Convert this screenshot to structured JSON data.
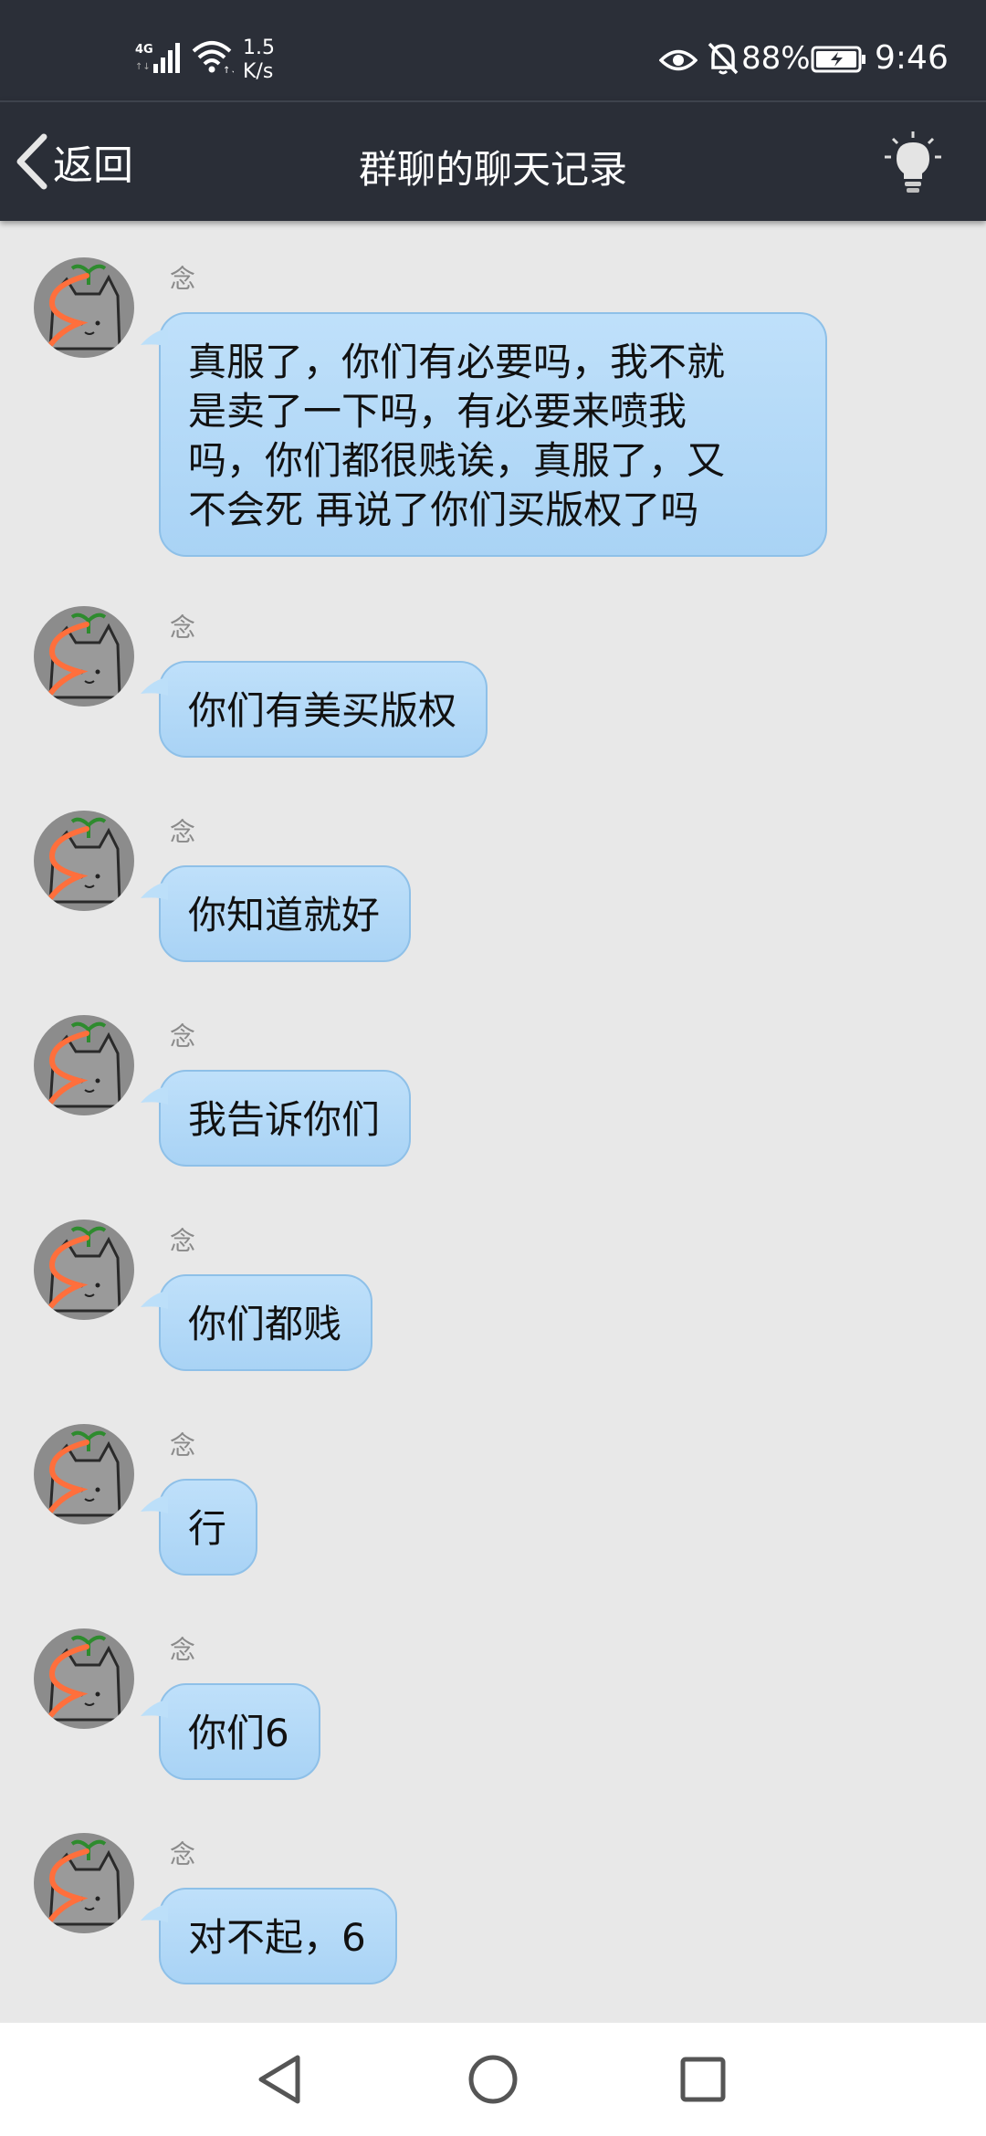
{
  "status_bar": {
    "network": "4G",
    "speed_value": "1.5",
    "speed_unit": "K/s",
    "battery": "88%",
    "time": "9:46"
  },
  "title_bar": {
    "back_label": "返回",
    "title": "群聊的聊天记录"
  },
  "messages": [
    {
      "sender": "念",
      "lines": [
        "真服了，你们有必要吗，我不就",
        "是卖了一下吗，有必要来喷我",
        "吗，你们都很贱诶，真服了，又",
        "不会死 再说了你们买版权了吗"
      ]
    },
    {
      "sender": "念",
      "text": "你们有美买版权"
    },
    {
      "sender": "念",
      "text": "你知道就好"
    },
    {
      "sender": "念",
      "text": "我告诉你们"
    },
    {
      "sender": "念",
      "text": "你们都贱"
    },
    {
      "sender": "念",
      "text": "行"
    },
    {
      "sender": "念",
      "text": "你们6"
    },
    {
      "sender": "念",
      "text": "对不起，6"
    }
  ],
  "icons": {
    "back": "chevron-left-icon",
    "bulb": "lightbulb-icon",
    "nav_back": "triangle-back-icon",
    "nav_home": "circle-home-icon",
    "nav_recents": "square-recents-icon"
  },
  "colors": {
    "bar_bg": "#2b2f38",
    "chat_bg": "#e8e8e8",
    "bubble": "#b3d8f7",
    "bubble_border": "#8ec0e8"
  }
}
